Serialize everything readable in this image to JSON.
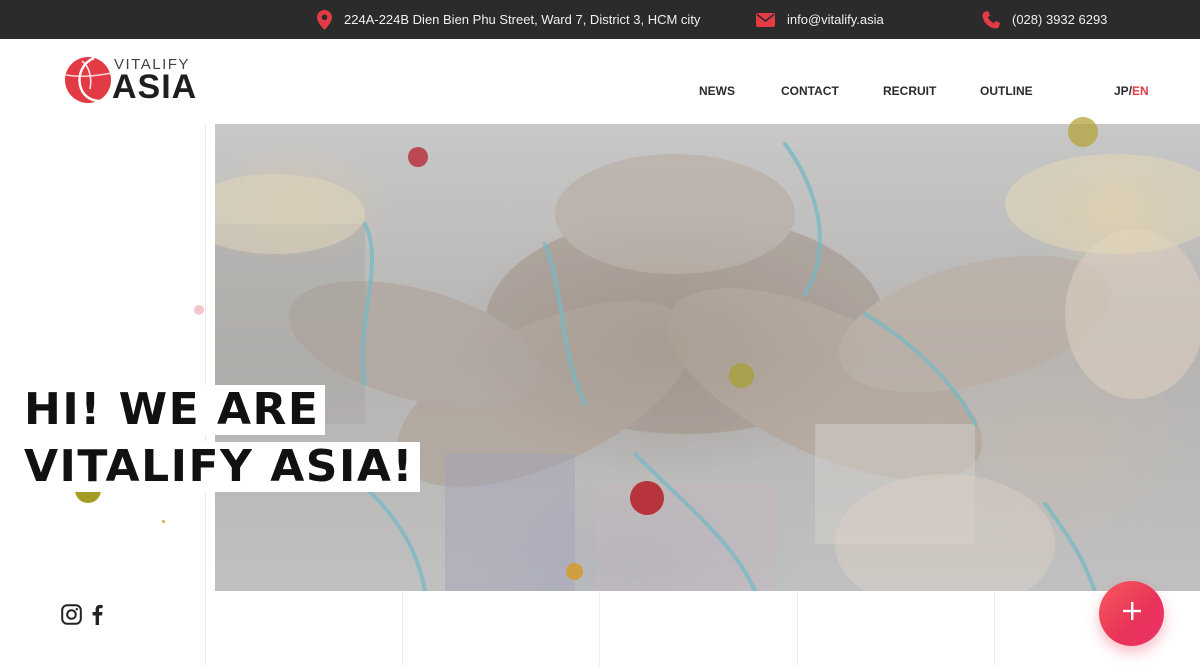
{
  "topbar": {
    "address": "224A-224B Dien Bien Phu Street, Ward 7, District 3, HCM city",
    "email": "info@vitalify.asia",
    "phone": "(028) 3932 6293",
    "icons": {
      "address": "map-pin-icon",
      "email": "envelope-icon",
      "phone": "phone-icon"
    },
    "icon_color": "#e23b46"
  },
  "brand": {
    "top": "VITALIFY",
    "main": "ASIA",
    "color": "#e23b46"
  },
  "nav": {
    "items": [
      "NEWS",
      "CONTACT",
      "RECRUIT",
      "OUTLINE"
    ]
  },
  "lang": {
    "jp": "JP",
    "separator": "/",
    "en": "EN",
    "active": "EN",
    "active_color": "#e23b46"
  },
  "hero": {
    "line1": "HI! WE ARE",
    "line2": "VITALIFY ASIA!"
  },
  "social": {
    "instagram": "instagram-icon",
    "facebook": "facebook-icon"
  },
  "fab": {
    "label": "+",
    "icon": "plus-icon",
    "color": "#ef3e5c"
  }
}
